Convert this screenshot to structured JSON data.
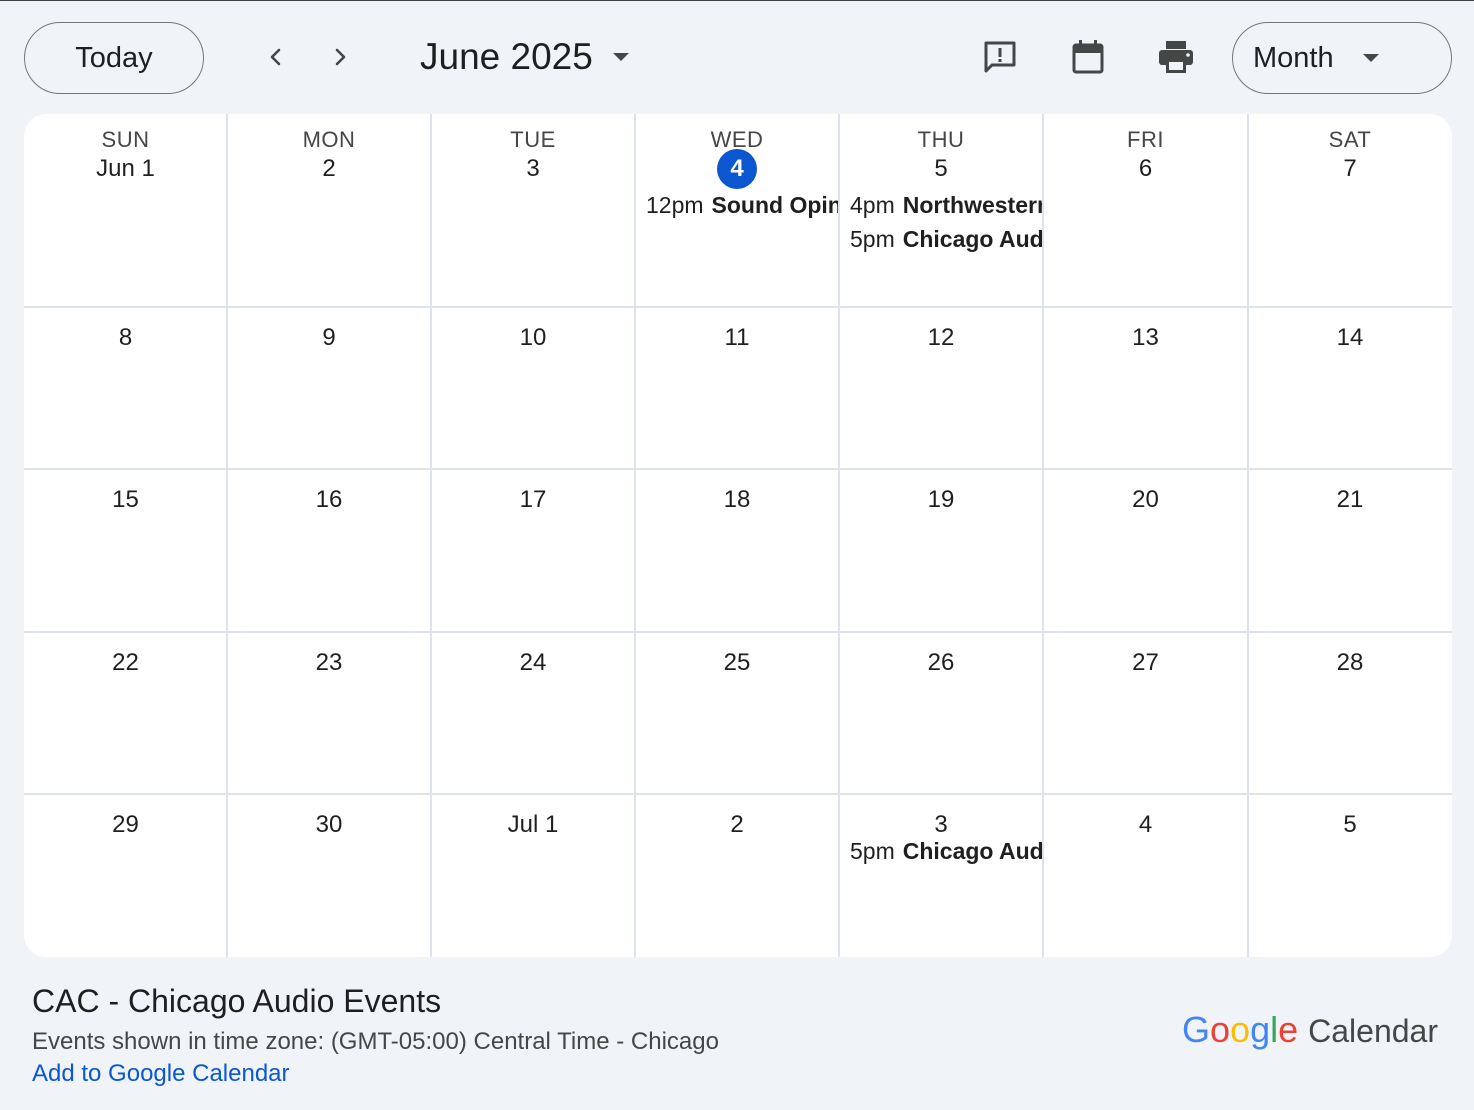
{
  "toolbar": {
    "today_label": "Today",
    "month_title": "June 2025",
    "view_label": "Month",
    "icons": [
      "chevron-left-icon",
      "chevron-right-icon",
      "feedback-icon",
      "calendar-icon",
      "print-icon",
      "caret-down-icon"
    ]
  },
  "weekdays": [
    "SUN",
    "MON",
    "TUE",
    "WED",
    "THU",
    "FRI",
    "SAT"
  ],
  "weeks": [
    [
      {
        "label": "Jun 1"
      },
      {
        "label": "2"
      },
      {
        "label": "3"
      },
      {
        "label": "4",
        "today": true,
        "events": [
          {
            "time": "12pm",
            "title": "Sound Opinions"
          }
        ]
      },
      {
        "label": "5",
        "events": [
          {
            "time": "4pm",
            "title": "Northwestern"
          },
          {
            "time": "5pm",
            "title": "Chicago Audio"
          }
        ]
      },
      {
        "label": "6"
      },
      {
        "label": "7"
      }
    ],
    [
      {
        "label": "8"
      },
      {
        "label": "9"
      },
      {
        "label": "10"
      },
      {
        "label": "11"
      },
      {
        "label": "12"
      },
      {
        "label": "13"
      },
      {
        "label": "14"
      }
    ],
    [
      {
        "label": "15"
      },
      {
        "label": "16"
      },
      {
        "label": "17"
      },
      {
        "label": "18"
      },
      {
        "label": "19"
      },
      {
        "label": "20"
      },
      {
        "label": "21"
      }
    ],
    [
      {
        "label": "22"
      },
      {
        "label": "23"
      },
      {
        "label": "24"
      },
      {
        "label": "25"
      },
      {
        "label": "26"
      },
      {
        "label": "27"
      },
      {
        "label": "28"
      }
    ],
    [
      {
        "label": "29"
      },
      {
        "label": "30"
      },
      {
        "label": "Jul 1"
      },
      {
        "label": "2"
      },
      {
        "label": "3",
        "events": [
          {
            "time": "5pm",
            "title": "Chicago Audio"
          }
        ]
      },
      {
        "label": "4"
      },
      {
        "label": "5"
      }
    ]
  ],
  "footer": {
    "calendar_name": "CAC - Chicago Audio Events",
    "timezone_text": "Events shown in time zone: (GMT-05:00) Central Time - Chicago",
    "add_link": "Add to Google Calendar",
    "logo_google": "Google",
    "logo_calendar": "Calendar"
  },
  "colors": {
    "accent": "#0b57d0",
    "background": "#f0f4f9",
    "grid_line": "#dde3ea"
  }
}
